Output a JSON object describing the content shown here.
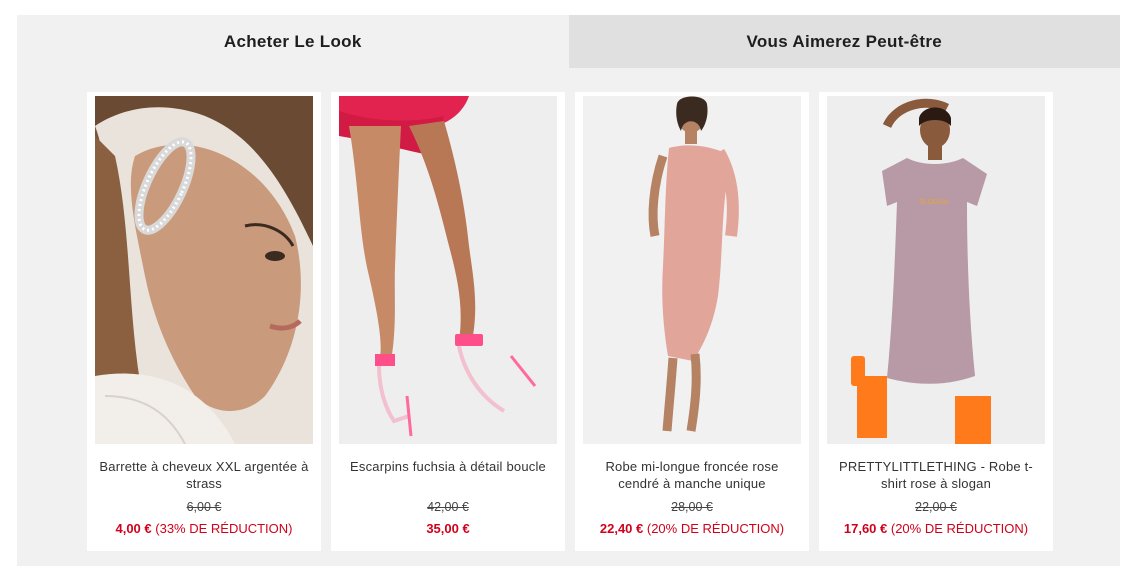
{
  "tabs": [
    {
      "label": "Acheter Le Look"
    },
    {
      "label": "Vous Aimerez Peut-être"
    }
  ],
  "products": [
    {
      "title": "Barrette à cheveux XXL argentée à strass",
      "old_price": "6,00 €",
      "sale_price": "4,00 €",
      "discount": "(33% DE RÉDUCTION)"
    },
    {
      "title": "Escarpins fuchsia à détail boucle",
      "old_price": "42,00 €",
      "sale_price": "35,00 €",
      "discount": ""
    },
    {
      "title": "Robe mi-longue froncée rose cendré à manche unique",
      "old_price": "28,00 €",
      "sale_price": "22,40 €",
      "discount": "(20% DE RÉDUCTION)"
    },
    {
      "title": "PRETTYLITTLETHING - Robe t-shirt rose à slogan",
      "old_price": "22,00 €",
      "sale_price": "17,60 €",
      "discount": "(20% DE RÉDUCTION)"
    }
  ],
  "colors": {
    "sale_red": "#d0021b",
    "panel_bg": "#f1f1f2",
    "inactive_tab_bg": "#e0e0e1"
  }
}
